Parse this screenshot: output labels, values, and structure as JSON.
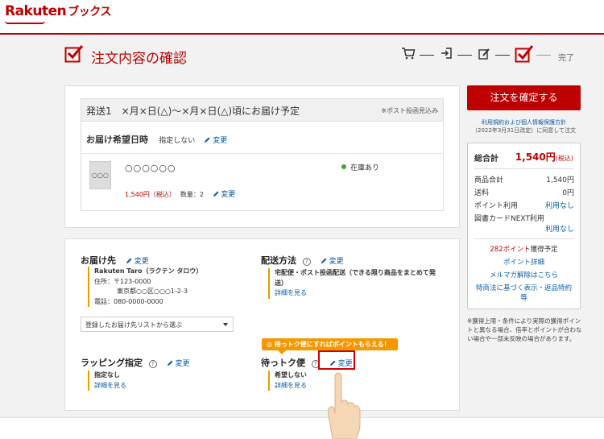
{
  "header": {
    "logo_text": "Rakuten",
    "logo_sub": "ブックス"
  },
  "page": {
    "title": "注文内容の確認"
  },
  "steps": {
    "done_label": "完了"
  },
  "shipment": {
    "title": "発送1　×月×日(△)～×月×日(△)頃にお届け予定",
    "note": "※ポスト投函見込み",
    "hope_label": "お届け希望日時",
    "hope_value": "指定しない",
    "edit_label": "変更",
    "product": {
      "thumb": "○○○",
      "name": "○○○○○○",
      "price": "1,540円（税込）",
      "qty": "数量：2",
      "edit_label": "変更",
      "stock": "在庫あり"
    }
  },
  "delivery": {
    "title": "お届け先",
    "edit_label": "変更",
    "name": "Rakuten Taro（ラクテン タロウ）",
    "zip": "住所：〒123-0000",
    "address": "東京都○○区○○○1-2-3",
    "phone": "電話：080-0000-0000",
    "select_text": "登録したお届け先リストから選ぶ"
  },
  "method": {
    "title": "配送方法",
    "edit_label": "変更",
    "text1": "宅配便・ポスト投函配送（できる限り商品をまとめて発",
    "text2": "送）",
    "link": "詳細を見る"
  },
  "wrapping": {
    "title": "ラッピング指定",
    "edit_label": "変更",
    "value": "指定なし",
    "link": "詳細を見る"
  },
  "wait": {
    "promo": "待っトク便にすればポイントもらえる！",
    "title": "待っトク便",
    "edit_label": "変更",
    "value": "希望しない",
    "link": "詳細を見る"
  },
  "sidebar": {
    "confirm_button": "注文を確定する",
    "terms_link": "利用規約および個人情報保護方針",
    "terms_text": "（2022年3月31日改定）に同意して注文",
    "total_label": "総合計",
    "total_value": "1,540円",
    "total_tax": "(税込)",
    "rows": [
      {
        "label": "商品合計",
        "value": "1,540円"
      },
      {
        "label": "送料",
        "value": "0円"
      },
      {
        "label": "ポイント利用",
        "value": "利用なし"
      },
      {
        "label": "図書カードNEXT利用",
        "value": "利用なし"
      }
    ],
    "points_earned": "282ポイント",
    "points_suffix": "獲得予定",
    "points_detail": "ポイント詳細",
    "mailmag": "メルマガ解除はこちら",
    "legal1": "特商法に基づく表示・返品特約",
    "legal2": "等",
    "footnote": "※獲得上限・条件により実際の獲得ポイントと異なる場合、倍率とポイントが合わない場合や一部未反映の場合があります。"
  },
  "colors": {
    "brand": "#bf0000",
    "link": "#0b5ea8",
    "promo": "#f39800"
  }
}
